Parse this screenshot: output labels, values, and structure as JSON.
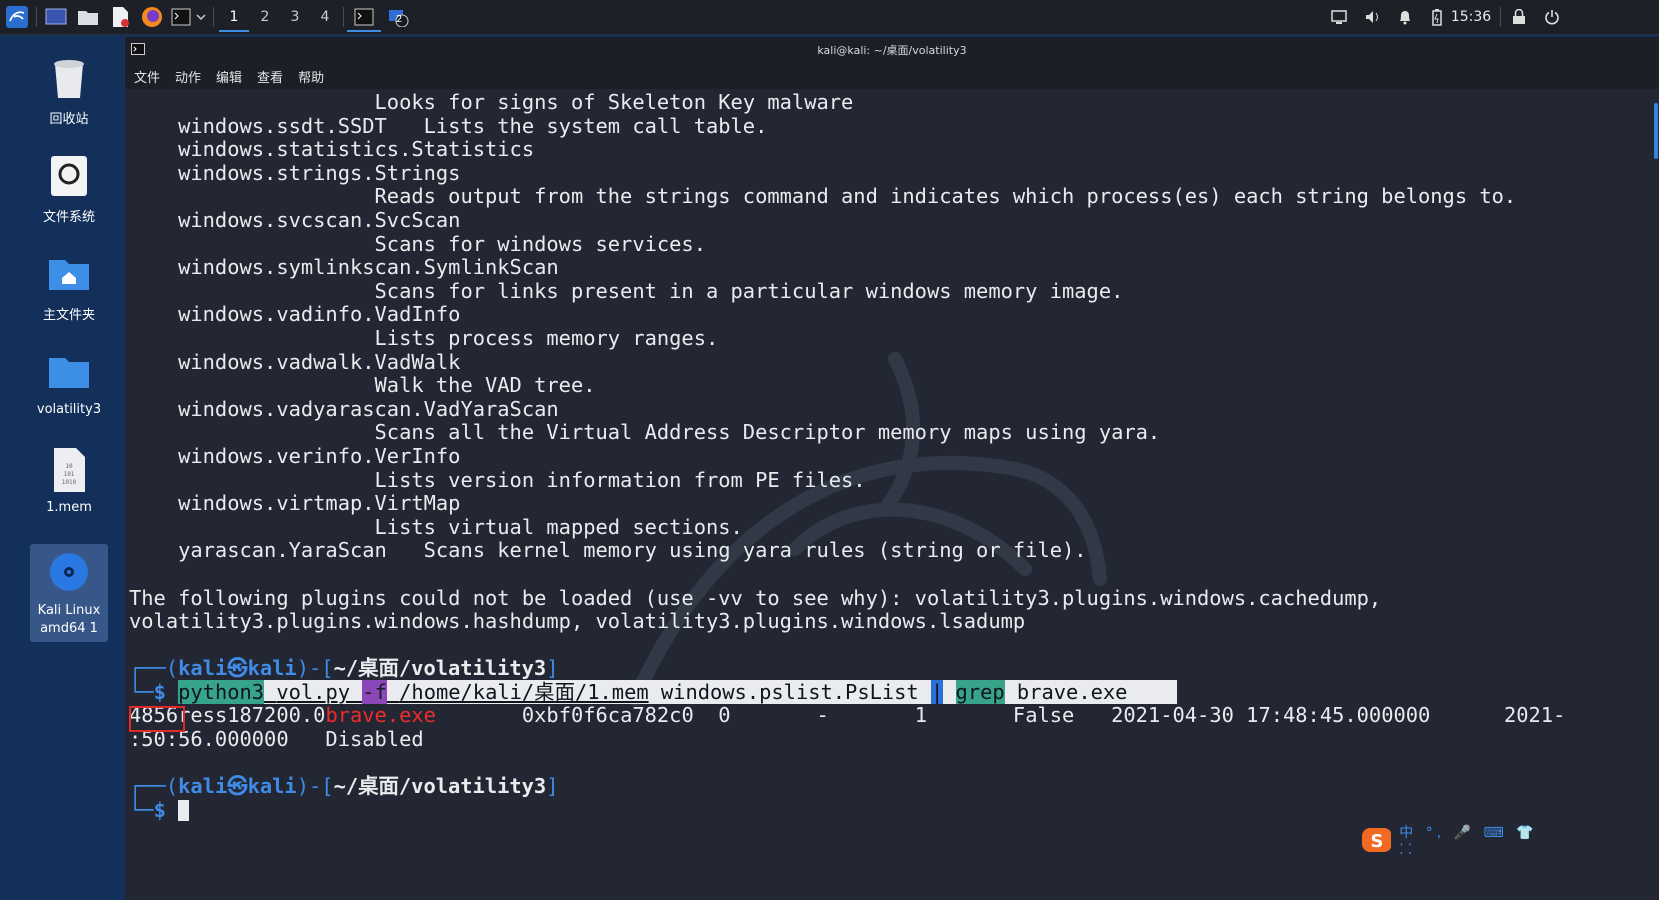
{
  "panel": {
    "workspaces": [
      "1",
      "2",
      "3",
      "4"
    ],
    "badge": "2",
    "clock": "15:36"
  },
  "desktop": {
    "icons": [
      {
        "label": "回收站"
      },
      {
        "label": "文件系统"
      },
      {
        "label": "主文件夹"
      },
      {
        "label": "volatility3"
      },
      {
        "label": "1.mem"
      },
      {
        "label": "Kali Linux amd64 1"
      }
    ],
    "mem_icon_text": "10\n101\n1010"
  },
  "window": {
    "title": "kali@kali: ~/桌面/volatility3",
    "menu": [
      "文件",
      "动作",
      "编辑",
      "查看",
      "帮助"
    ]
  },
  "terminal": {
    "lines": [
      "                    Looks for signs of Skeleton Key malware",
      "    windows.ssdt.SSDT   Lists the system call table.",
      "    windows.statistics.Statistics",
      "    windows.strings.Strings",
      "                    Reads output from the strings command and indicates which process(es) each string belongs to.",
      "    windows.svcscan.SvcScan",
      "                    Scans for windows services.",
      "    windows.symlinkscan.SymlinkScan",
      "                    Scans for links present in a particular windows memory image.",
      "    windows.vadinfo.VadInfo",
      "                    Lists process memory ranges.",
      "    windows.vadwalk.VadWalk",
      "                    Walk the VAD tree.",
      "    windows.vadyarascan.VadYaraScan",
      "                    Scans all the Virtual Address Descriptor memory maps using yara.",
      "    windows.verinfo.VerInfo",
      "                    Lists version information from PE files.",
      "    windows.virtmap.VirtMap",
      "                    Lists virtual mapped sections.",
      "    yarascan.YaraScan   Scans kernel memory using yara rules (string or file).",
      "",
      "The following plugins could not be loaded (use -vv to see why): volatility3.plugins.windows.cachedump,",
      "volatility3.plugins.windows.hashdump, volatility3.plugins.windows.lsadump"
    ],
    "prompt1": {
      "corner_top": "┌──(",
      "user": "kali㉿kali",
      "mid": ")-[",
      "path": "~/桌面/volatility3",
      "end": "]",
      "corner_bottom": "└─",
      "dollar": "$ "
    },
    "command": {
      "python": "python3",
      "script": "vol.py",
      "flag": "-f",
      "file": "/home/kali/桌面/1.mem",
      "plugin": " windows.pslist.PsList ",
      "pipe": "|",
      "grep": "grep",
      "arg": " brave.exe    "
    },
    "output": {
      "pid": "4856",
      "rest_a": "ress187200.0",
      "brave": "brave.exe",
      "rest_b": "       0xbf0f6ca782c0  0       -       1       False   2021-04-30 17:48:45.000000      2021-",
      "line2": ":50:56.000000   Disabled"
    },
    "prompt2": {
      "user": "kali㉿kali",
      "path": "~/桌面/volatility3"
    }
  },
  "ime": {
    "label": "中 °, 🎤 ⌨ 👕 ⁚⁚"
  }
}
